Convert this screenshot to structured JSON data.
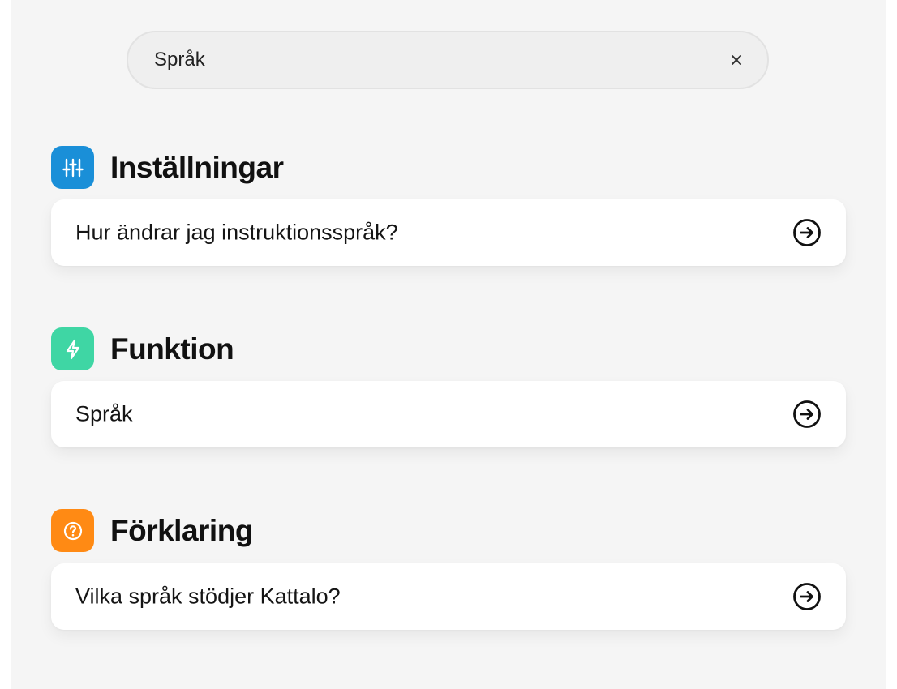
{
  "search": {
    "value": "Språk",
    "clear_symbol": "×",
    "clear_icon": "close-icon"
  },
  "sections": [
    {
      "title": "Inställningar",
      "icon": "sliders-icon",
      "icon_color": "#1a8fd8",
      "results": [
        {
          "label": "Hur ändrar jag instruktionsspråk?",
          "icon": "arrow-right-circle-icon"
        }
      ]
    },
    {
      "title": "Funktion",
      "icon": "lightning-icon",
      "icon_color": "#3fd6a4",
      "results": [
        {
          "label": "Språk",
          "icon": "arrow-right-circle-icon"
        }
      ]
    },
    {
      "title": "Förklaring",
      "icon": "question-circle-icon",
      "icon_color": "#ff8a14",
      "results": [
        {
          "label": "Vilka språk stödjer Kattalo?",
          "icon": "arrow-right-circle-icon"
        }
      ]
    }
  ]
}
